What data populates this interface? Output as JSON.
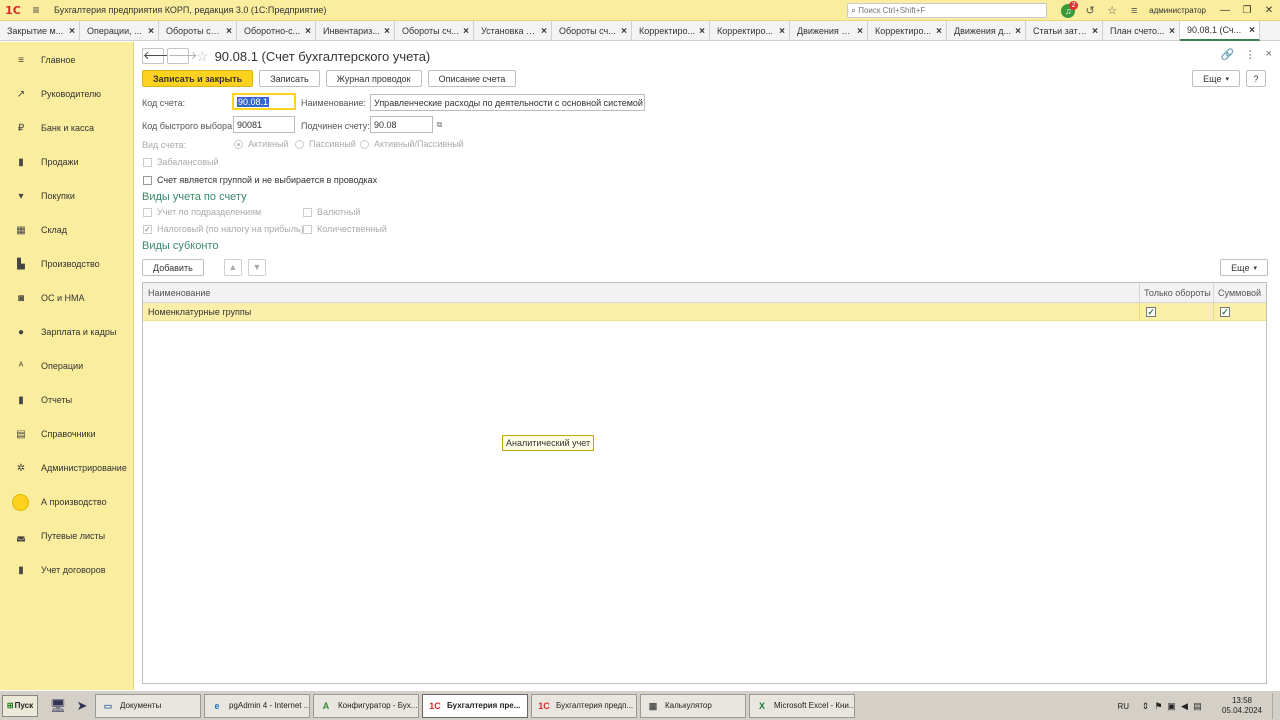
{
  "titlebar": {
    "logo": "1С",
    "title": "Бухгалтерия предприятия КОРП, редакция 3.0  (1С:Предприятие)",
    "search_placeholder": "Поиск Ctrl+Shift+F",
    "notifications_count": "2",
    "user": "администратор"
  },
  "tabs": [
    {
      "label": "Закрытие м..."
    },
    {
      "label": "Операции, ..."
    },
    {
      "label": "Обороты сч..."
    },
    {
      "label": "Оборотно-с..."
    },
    {
      "label": "Инвентариз..."
    },
    {
      "label": "Обороты сч..."
    },
    {
      "label": "Установка з..."
    },
    {
      "label": "Обороты сч..."
    },
    {
      "label": "Корректиро..."
    },
    {
      "label": "Корректиро..."
    },
    {
      "label": "Движения д..."
    },
    {
      "label": "Корректиро..."
    },
    {
      "label": "Движения д..."
    },
    {
      "label": "Статьи затрат"
    },
    {
      "label": "План счето..."
    },
    {
      "label": "90.08.1 (Сч..."
    }
  ],
  "sidebar": {
    "items": [
      {
        "label": "Главное",
        "icon": "≡"
      },
      {
        "label": "Руководителю",
        "icon": "↗"
      },
      {
        "label": "Банк и касса",
        "icon": "₽"
      },
      {
        "label": "Продажи",
        "icon": "▮"
      },
      {
        "label": "Покупки",
        "icon": "▾"
      },
      {
        "label": "Склад",
        "icon": "▦"
      },
      {
        "label": "Производство",
        "icon": "▙"
      },
      {
        "label": "ОС и НМА",
        "icon": "◙"
      },
      {
        "label": "Зарплата и кадры",
        "icon": "●"
      },
      {
        "label": "Операции",
        "icon": "ᴬ"
      },
      {
        "label": "Отчеты",
        "icon": "▮"
      },
      {
        "label": "Справочники",
        "icon": "▤"
      },
      {
        "label": "Администрирование",
        "icon": "✲"
      },
      {
        "label": "А производство",
        "icon": "circle"
      },
      {
        "label": "Путевые листы",
        "icon": "◛"
      },
      {
        "label": "Учет договоров",
        "icon": "▮"
      }
    ]
  },
  "form": {
    "title": "90.08.1 (Счет бухгалтерского учета)",
    "buttons": {
      "save_close": "Записать и закрыть",
      "save": "Записать",
      "journal": "Журнал проводок",
      "description": "Описание счета",
      "more": "Еще",
      "help": "?"
    },
    "code_label": "Код счета:",
    "code_value": "90.08.1",
    "name_label": "Наименование:",
    "name_value": "Управленческие расходы по деятельности с основной системой на",
    "quick_code_label": "Код быстрого выбора:",
    "quick_code_value": "90081",
    "parent_label": "Подчинен счету:",
    "parent_value": "90.08",
    "type_label": "Вид счета:",
    "type_options": [
      "Активный",
      "Пассивный",
      "Активный/Пассивный"
    ],
    "offbalance_label": "Забалансовый",
    "group_label": "Счет является группой и не выбирается в проводках",
    "section_accounting": "Виды учета по счету",
    "acc_subdiv": "Учет по подразделениям",
    "acc_currency": "Валютный",
    "acc_tax": "Налоговый (по налогу на прибыль)",
    "acc_quantity": "Количественный",
    "section_subconto": "Виды субконто",
    "add_button": "Добавить",
    "up_icon": "▲",
    "down_icon": "▼",
    "grid": {
      "columns": [
        "Наименование",
        "Только обороты",
        "Суммовой"
      ],
      "rows": [
        {
          "name": "Номенклатурные группы",
          "turnover": "✓",
          "sum": "✓"
        }
      ]
    },
    "tooltip": "Аналитический учет"
  },
  "taskbar": {
    "start": "Пуск",
    "tasks": [
      {
        "label": "Документы",
        "icon": "▭",
        "color": "#3a6ea5"
      },
      {
        "label": "pgAdmin 4 - Internet ...",
        "icon": "e",
        "color": "#1e73be"
      },
      {
        "label": "Конфигуратор - Бух...",
        "icon": "A",
        "color": "#2e8b2e"
      },
      {
        "label": "Бухгалтерия пре...",
        "icon": "1С",
        "color": "#d42a2a"
      },
      {
        "label": "Бухгалтерия предп...",
        "icon": "1С",
        "color": "#d42a2a"
      },
      {
        "label": "Калькулятор",
        "icon": "▦",
        "color": "#555555"
      },
      {
        "label": "Microsoft Excel - Кни...",
        "icon": "X",
        "color": "#1d7a3a"
      }
    ],
    "lang": "RU",
    "time": "13:58",
    "date": "05.04.2024"
  }
}
